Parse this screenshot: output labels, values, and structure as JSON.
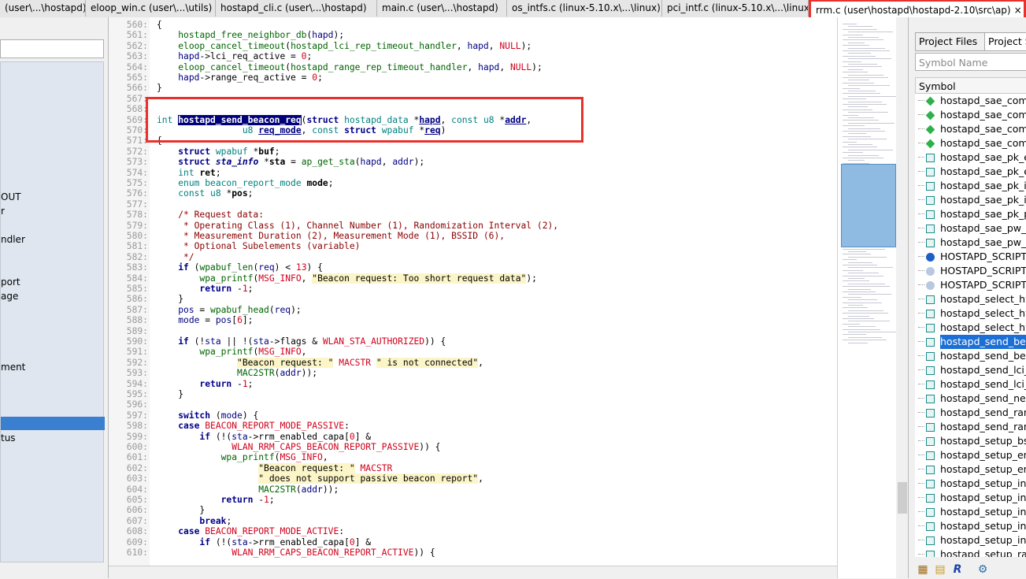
{
  "tabs": [
    {
      "label": "(user\\...\\hostapd)"
    },
    {
      "label": "eloop_win.c (user\\...\\utils)"
    },
    {
      "label": "hostapd_cli.c (user\\...\\hostapd)"
    },
    {
      "label": "main.c (user\\...\\hostapd)"
    },
    {
      "label": "os_intfs.c (linux-5.10.x\\...\\linux)"
    },
    {
      "label": "pci_intf.c (linux-5.10.x\\...\\linux)"
    },
    {
      "label": "rrm.c (user\\hostapd\\hostapd-2.10\\src\\ap)",
      "close": "×"
    }
  ],
  "left_panel": {
    "items": [
      "OUT",
      "r",
      "ndler",
      "port",
      "age",
      "ment",
      "tus"
    ]
  },
  "code": {
    "lines": [
      {
        "n": "560:",
        "html": "<span>{</span>"
      },
      {
        "n": "561:",
        "html": "    <span class='fn'>hostapd_free_neighbor_db</span>(<span class='vr'>hapd</span>);"
      },
      {
        "n": "562:",
        "html": "    <span class='fn'>eloop_cancel_timeout</span>(<span class='fn'>hostapd_lci_rep_timeout_handler</span>, <span class='vr'>hapd</span>, <span class='mc'>NULL</span>);"
      },
      {
        "n": "563:",
        "html": "    <span class='vr'>hapd</span>-&gt;lci_req_active = <span class='num'>0</span>;"
      },
      {
        "n": "564:",
        "html": "    <span class='fn'>eloop_cancel_timeout</span>(<span class='fn'>hostapd_range_rep_timeout_handler</span>, <span class='vr'>hapd</span>, <span class='mc'>NULL</span>);"
      },
      {
        "n": "565:",
        "html": "    <span class='vr'>hapd</span>-&gt;range_req_active = <span class='num'>0</span>;"
      },
      {
        "n": "566:",
        "html": "}"
      },
      {
        "n": "567:",
        "html": ""
      },
      {
        "n": "568:",
        "html": ""
      },
      {
        "n": "569:",
        "html": "<span class='tp'>int</span> <span class='sel'>hostapd_send_beacon_req</span>(<span class='kw'>struct</span> <span class='tp'>hostapd_data</span> *<span class='ul'>hapd</span>, <span class='tp'>const u8</span> *<span class='ul'>addr</span>,"
      },
      {
        "n": "570:",
        "html": "                <span class='tp'>u8</span> <span class='ul'>req_mode</span>, <span class='tp'>const</span> <span class='kw'>struct</span> <span class='tp'>wpabuf</span> *<span class='ul'>req</span>)"
      },
      {
        "n": "571:",
        "html": "{"
      },
      {
        "n": "572:",
        "html": "    <span class='kw'>struct</span> <span class='tp'>wpabuf</span> *<b>buf</b>;"
      },
      {
        "n": "573:",
        "html": "    <span class='kw'>struct</span> <i class='vr'><b>sta_info</b></i> *<b>sta</b> = <span class='fn'>ap_get_sta</span>(<span class='vr'>hapd</span>, <span class='vr'>addr</span>);"
      },
      {
        "n": "574:",
        "html": "    <span class='tp'>int</span> <b>ret</b>;"
      },
      {
        "n": "575:",
        "html": "    <span class='tp'>enum beacon_report_mode</span> <b>mode</b>;"
      },
      {
        "n": "576:",
        "html": "    <span class='tp'>const u8</span> *<b>pos</b>;"
      },
      {
        "n": "577:",
        "html": ""
      },
      {
        "n": "578:",
        "html": "    <span class='cm'>/* Request data:</span>"
      },
      {
        "n": "579:",
        "html": "<span class='cm'>     * Operating Class (1), Channel Number (1), Randomization Interval (2),</span>"
      },
      {
        "n": "580:",
        "html": "<span class='cm'>     * Measurement Duration (2), Measurement Mode (1), BSSID (6),</span>"
      },
      {
        "n": "581:",
        "html": "<span class='cm'>     * Optional Subelements (variable)</span>"
      },
      {
        "n": "582:",
        "html": "<span class='cm'>     */</span>"
      },
      {
        "n": "583:",
        "html": "    <span class='kw'>if</span> (<span class='fn'>wpabuf_len</span>(<span class='vr'>req</span>) &lt; <span class='num'>13</span>) {"
      },
      {
        "n": "584:",
        "html": "        <span class='fn'>wpa_printf</span>(<span class='mc'>MSG_INFO</span>, <span class='str'>\"Beacon request: Too short request data\"</span>);"
      },
      {
        "n": "585:",
        "html": "        <span class='kw'>return</span> -<span class='num'>1</span>;"
      },
      {
        "n": "586:",
        "html": "    }"
      },
      {
        "n": "587:",
        "html": "    <span class='vr'>pos</span> = <span class='fn'>wpabuf_head</span>(<span class='vr'>req</span>);"
      },
      {
        "n": "588:",
        "html": "    <span class='vr'>mode</span> = <span class='vr'>pos</span>[<span class='num'>6</span>];"
      },
      {
        "n": "589:",
        "html": ""
      },
      {
        "n": "590:",
        "html": "    <span class='kw'>if</span> (!<span class='vr'>sta</span> || !(<span class='vr'>sta</span>-&gt;flags &amp; <span class='mc'>WLAN_STA_AUTHORIZED</span>)) {"
      },
      {
        "n": "591:",
        "html": "        <span class='fn'>wpa_printf</span>(<span class='mc'>MSG_INFO</span>,"
      },
      {
        "n": "592:",
        "html": "               <span class='str'>\"Beacon request: \"</span> <span class='mc'>MACSTR</span> <span class='str'>\" is not connected\"</span>,"
      },
      {
        "n": "593:",
        "html": "               <span class='fn'>MAC2STR</span>(<span class='vr'>addr</span>));"
      },
      {
        "n": "594:",
        "html": "        <span class='kw'>return</span> -<span class='num'>1</span>;"
      },
      {
        "n": "595:",
        "html": "    }"
      },
      {
        "n": "596:",
        "html": ""
      },
      {
        "n": "597:",
        "html": "    <span class='kw'>switch</span> (<span class='vr'>mode</span>) {"
      },
      {
        "n": "598:",
        "html": "    <span class='kw'>case</span> <span class='mc'>BEACON_REPORT_MODE_PASSIVE</span>:"
      },
      {
        "n": "599:",
        "html": "        <span class='kw'>if</span> (!(<span class='vr'>sta</span>-&gt;rrm_enabled_capa[<span class='num'>0</span>] &amp;"
      },
      {
        "n": "600:",
        "html": "              <span class='mc'>WLAN_RRM_CAPS_BEACON_REPORT_PASSIVE</span>)) {"
      },
      {
        "n": "601:",
        "html": "            <span class='fn'>wpa_printf</span>(<span class='mc'>MSG_INFO</span>,"
      },
      {
        "n": "602:",
        "html": "                   <span class='str'>\"Beacon request: \"</span> <span class='mc'>MACSTR</span>"
      },
      {
        "n": "603:",
        "html": "                   <span class='str'>\" does not support passive beacon report\"</span>,"
      },
      {
        "n": "604:",
        "html": "                   <span class='fn'>MAC2STR</span>(<span class='vr'>addr</span>));"
      },
      {
        "n": "605:",
        "html": "            <span class='kw'>return</span> -<span class='num'>1</span>;"
      },
      {
        "n": "606:",
        "html": "        }"
      },
      {
        "n": "607:",
        "html": "        <span class='kw'>break</span>;"
      },
      {
        "n": "608:",
        "html": "    <span class='kw'>case</span> <span class='mc'>BEACON_REPORT_MODE_ACTIVE</span>:"
      },
      {
        "n": "609:",
        "html": "        <span class='kw'>if</span> (!(<span class='vr'>sta</span>-&gt;rrm_enabled_capa[<span class='num'>0</span>] &amp;"
      },
      {
        "n": "610:",
        "html": "              <span class='mc'>WLAN_RRM_CAPS_BEACON_REPORT_ACTIVE</span>)) {"
      }
    ]
  },
  "right_panel": {
    "tabs": [
      "Project Files",
      "Project S"
    ],
    "symbol_name_placeholder": "Symbol Name",
    "symbol_header": "Symbol",
    "symbols": [
      {
        "label": "hostapd_sae_comm",
        "icon": "diamond"
      },
      {
        "label": "hostapd_sae_comm",
        "icon": "diamond"
      },
      {
        "label": "hostapd_sae_comm",
        "icon": "diamond"
      },
      {
        "label": "hostapd_sae_comm",
        "icon": "diamond"
      },
      {
        "label": "hostapd_sae_pk_ex",
        "icon": "struct"
      },
      {
        "label": "hostapd_sae_pk_ex",
        "icon": "struct"
      },
      {
        "label": "hostapd_sae_pk_in",
        "icon": "struct"
      },
      {
        "label": "hostapd_sae_pk_in",
        "icon": "struct"
      },
      {
        "label": "hostapd_sae_pk_pa",
        "icon": "struct"
      },
      {
        "label": "hostapd_sae_pw_id",
        "icon": "struct"
      },
      {
        "label": "hostapd_sae_pw_id",
        "icon": "struct"
      },
      {
        "label": "HOSTAPD_SCRIPT_",
        "icon": "macro"
      },
      {
        "label": "HOSTAPD_SCRIPT_",
        "icon": "macro2"
      },
      {
        "label": "HOSTAPD_SCRIPT_",
        "icon": "macro2"
      },
      {
        "label": "hostapd_select_hw",
        "icon": "struct"
      },
      {
        "label": "hostapd_select_hw",
        "icon": "struct"
      },
      {
        "label": "hostapd_select_hw",
        "icon": "struct"
      },
      {
        "label": "hostapd_send_bea",
        "icon": "struct",
        "selected": true
      },
      {
        "label": "hostapd_send_bea",
        "icon": "struct"
      },
      {
        "label": "hostapd_send_lci_r",
        "icon": "struct"
      },
      {
        "label": "hostapd_send_lci_r",
        "icon": "struct"
      },
      {
        "label": "hostapd_send_nei_",
        "icon": "struct"
      },
      {
        "label": "hostapd_send_rang",
        "icon": "struct"
      },
      {
        "label": "hostapd_send_rang",
        "icon": "struct"
      },
      {
        "label": "hostapd_setup_bss",
        "icon": "struct"
      },
      {
        "label": "hostapd_setup_enc",
        "icon": "struct"
      },
      {
        "label": "hostapd_setup_enc",
        "icon": "struct"
      },
      {
        "label": "hostapd_setup_inte",
        "icon": "struct"
      },
      {
        "label": "hostapd_setup_inte",
        "icon": "struct"
      },
      {
        "label": "hostapd_setup_inte",
        "icon": "struct"
      },
      {
        "label": "hostapd_setup_inte",
        "icon": "struct"
      },
      {
        "label": "hostapd_setup_inte",
        "icon": "struct"
      },
      {
        "label": "hostapd_setup_rad",
        "icon": "struct"
      }
    ]
  }
}
